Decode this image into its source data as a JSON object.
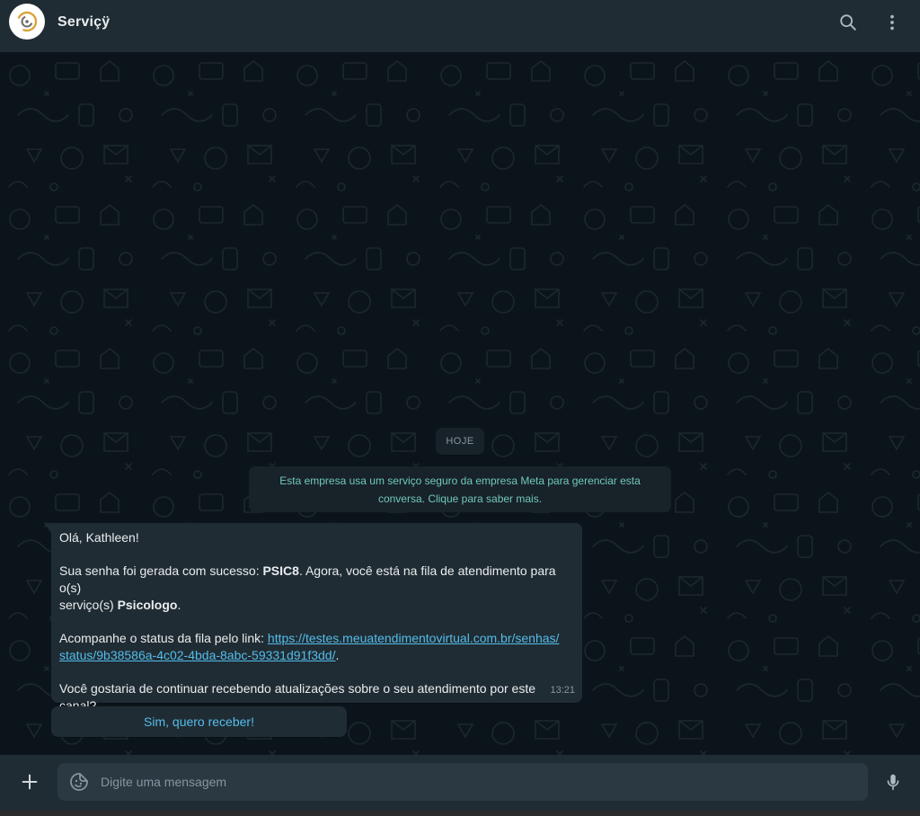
{
  "header": {
    "contact_name": "Serviçÿ",
    "avatar_icon": "logo-icon",
    "search_icon": "search-icon",
    "menu_icon": "more-vertical-icon"
  },
  "chat": {
    "date_label": "HOJE",
    "system_notice": {
      "line1": "Esta empresa usa um serviço seguro da empresa Meta para gerenciar esta",
      "line2": "conversa. Clique para saber mais."
    },
    "message": {
      "greeting": "Olá, Kathleen!",
      "p2_before": "Sua senha foi gerada com sucesso: ",
      "p2_code": "PSIC8",
      "p2_after": ". Agora, você está na fila de atendimento para o(s)",
      "p2_line2_before": "serviço(s) ",
      "p2_service": "Psicologo",
      "p2_line2_after": ".",
      "p3_before": "Acompanhe o status da fila pelo link: ",
      "link_line1": "https://testes.meuatendimentovirtual.com.br/senhas/",
      "link_line2": "status/9b38586a-4c02-4bda-8abc-59331d91f3dd/",
      "p3_after": ".",
      "p4": "Você gostaria de continuar recebendo atualizações sobre o seu atendimento por este canal?",
      "time": "13:21"
    },
    "quick_reply": "Sim, quero receber!"
  },
  "composer": {
    "placeholder": "Digite uma mensagem",
    "value": ""
  },
  "colors": {
    "header_bg": "#202c33",
    "chat_bg": "#0b141a",
    "bubble_bg": "#202c33",
    "link": "#53bdeb",
    "system_text": "#6fc9b9"
  }
}
